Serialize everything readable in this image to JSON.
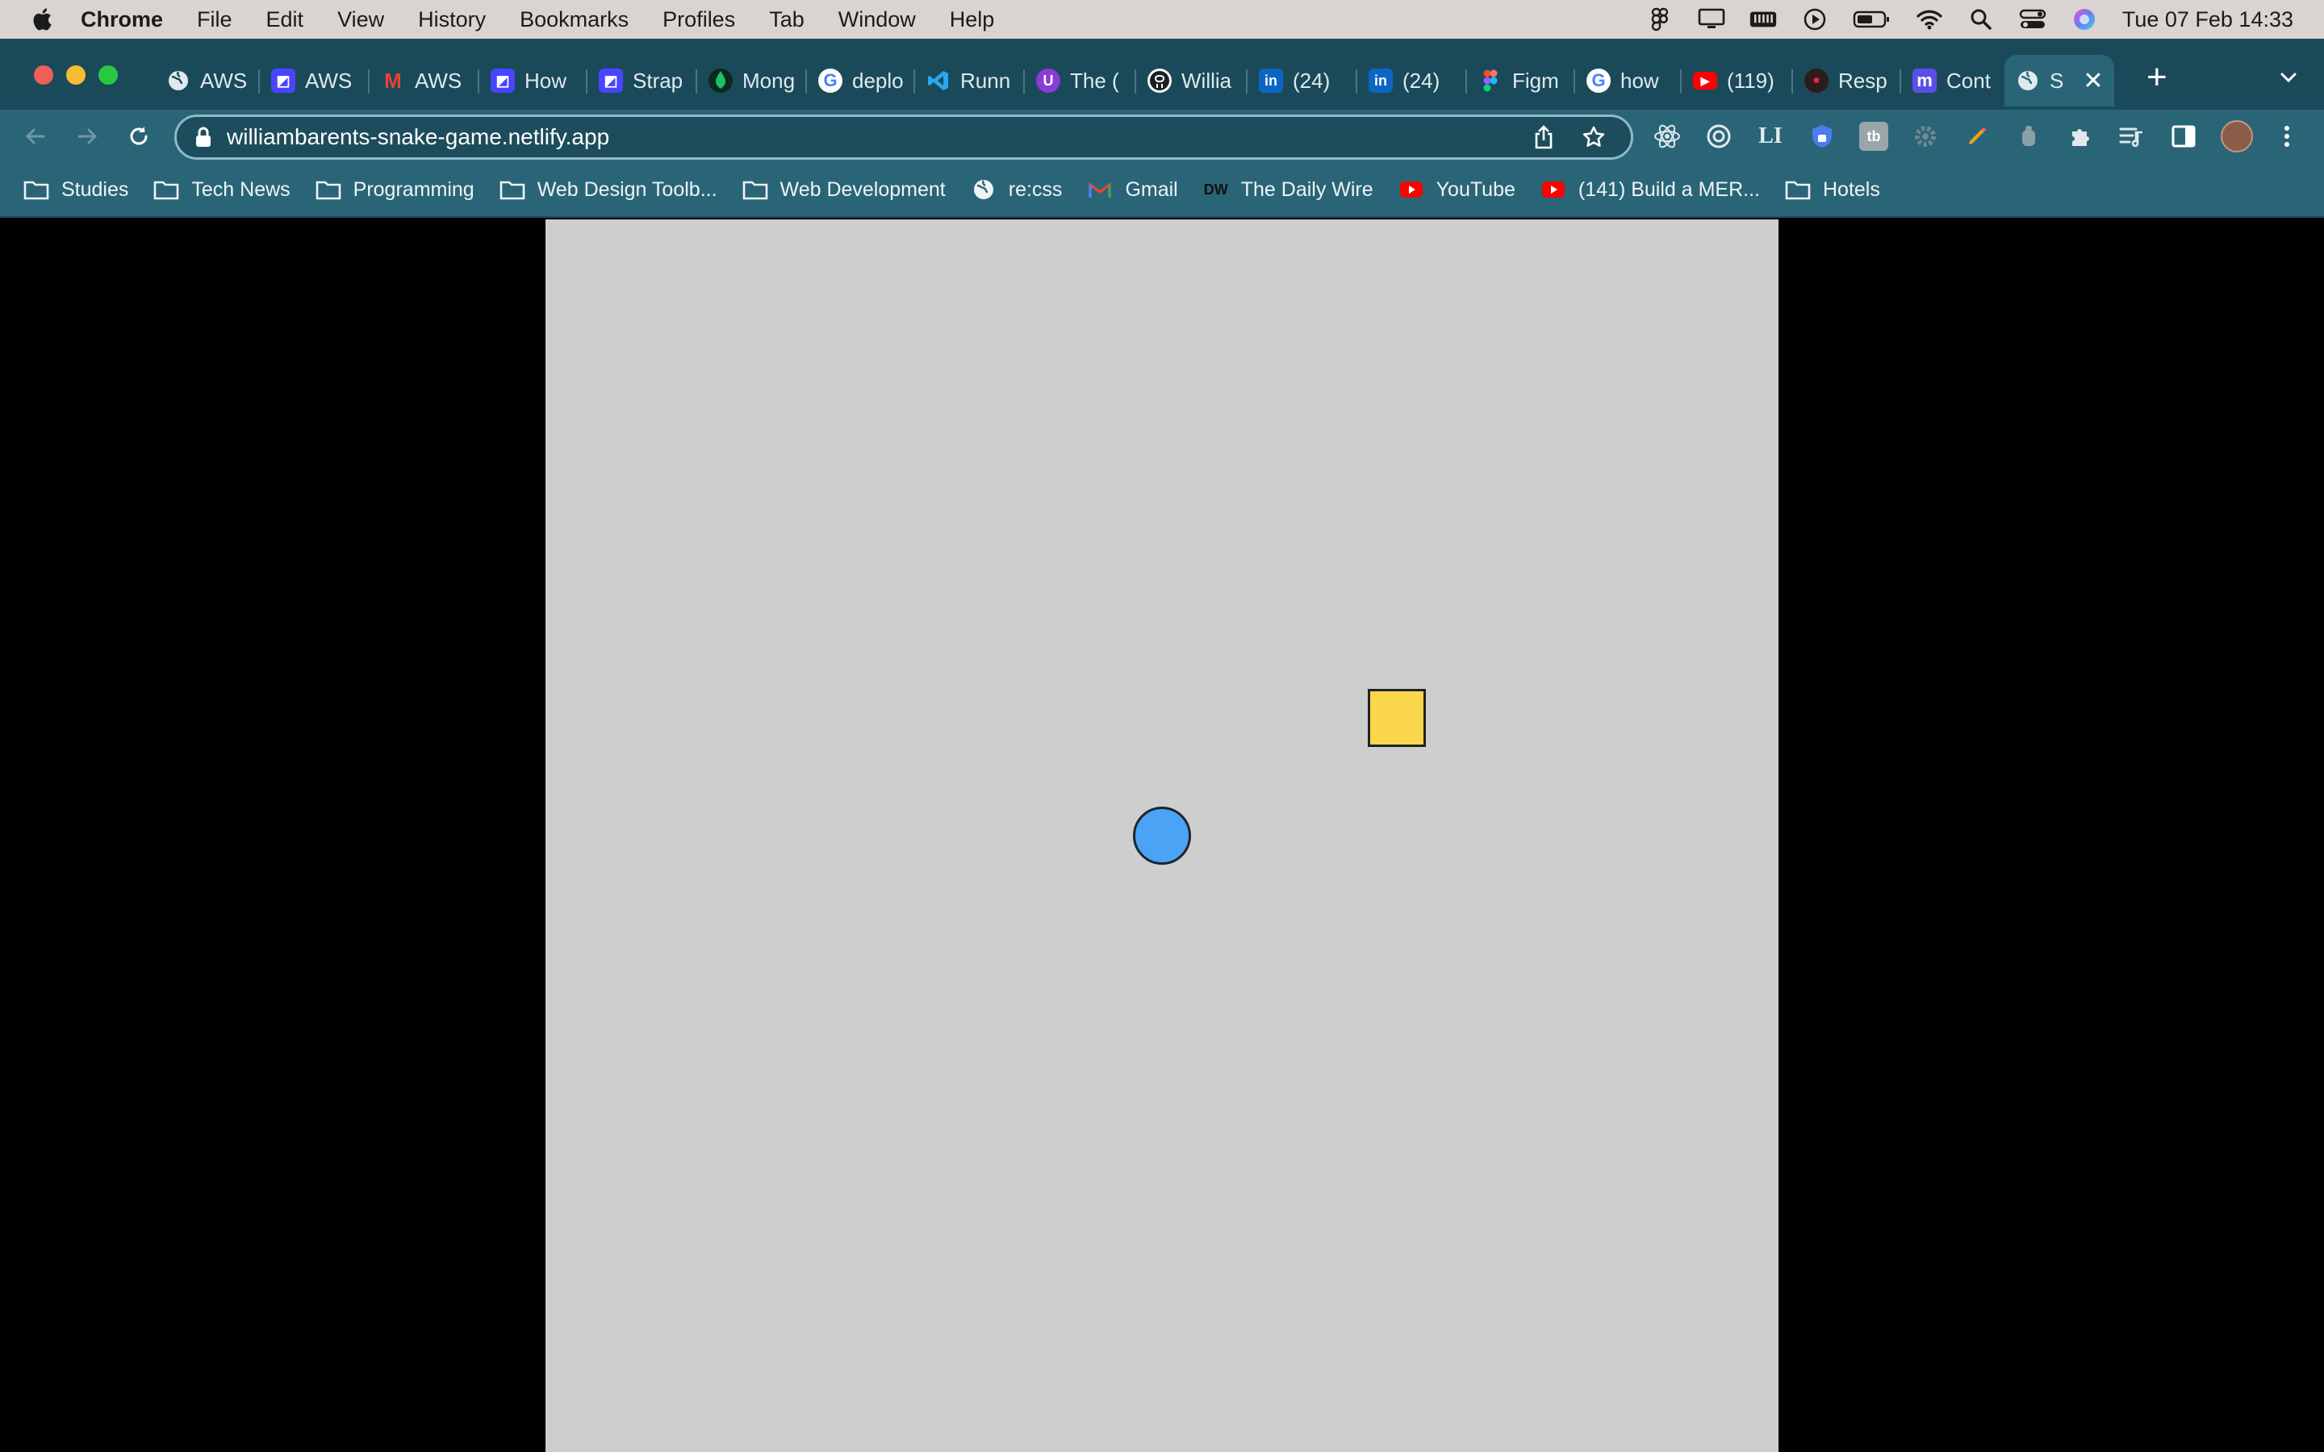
{
  "menubar": {
    "app_name": "Chrome",
    "items": [
      "File",
      "Edit",
      "View",
      "History",
      "Bookmarks",
      "Profiles",
      "Tab",
      "Window",
      "Help"
    ],
    "clock": "Tue 07 Feb  14:33",
    "status_icons": [
      "figma-icon",
      "display-icon",
      "memory-icon",
      "play-icon",
      "battery-icon",
      "wifi-icon",
      "spotlight-search-icon",
      "control-center-icon",
      "siri-icon"
    ]
  },
  "tabs": [
    {
      "title": "AWS",
      "icon": "globe-icon"
    },
    {
      "title": "AWS",
      "icon": "strapi-icon"
    },
    {
      "title": "AWS",
      "icon": "gmail-icon"
    },
    {
      "title": "How",
      "icon": "strapi-icon"
    },
    {
      "title": "Strap",
      "icon": "strapi-icon"
    },
    {
      "title": "Mong",
      "icon": "mongodb-icon"
    },
    {
      "title": "deplo",
      "icon": "google-icon"
    },
    {
      "title": "Runn",
      "icon": "vscode-icon"
    },
    {
      "title": "The (",
      "icon": "ublock-icon"
    },
    {
      "title": "Willia",
      "icon": "github-icon"
    },
    {
      "title": "(24)",
      "icon": "linkedin-icon"
    },
    {
      "title": "(24)",
      "icon": "linkedin-icon"
    },
    {
      "title": "Figm",
      "icon": "figma-icon"
    },
    {
      "title": "how",
      "icon": "google-icon"
    },
    {
      "title": "(119)",
      "icon": "youtube-icon"
    },
    {
      "title": "Resp",
      "icon": "spy-icon"
    },
    {
      "title": "Cont",
      "icon": "m-icon"
    },
    {
      "title": "S",
      "icon": "globe-icon",
      "active": true
    }
  ],
  "toolbar": {
    "url": "williambarents-snake-game.netlify.app",
    "extensions": [
      "react-devtools-icon",
      "target-icon",
      "LI",
      "shield-lock-icon",
      "tb",
      "gear-icon",
      "pencil-icon",
      "cup-icon",
      "puzzle-icon",
      "reading-list-icon",
      "side-panel-icon"
    ]
  },
  "bookmarks": [
    {
      "label": "Studies",
      "icon": "folder-icon"
    },
    {
      "label": "Tech News",
      "icon": "folder-icon"
    },
    {
      "label": "Programming",
      "icon": "folder-icon"
    },
    {
      "label": "Web Design Toolb...",
      "icon": "folder-icon"
    },
    {
      "label": "Web Development",
      "icon": "folder-icon"
    },
    {
      "label": "re:css",
      "icon": "globe-icon"
    },
    {
      "label": "Gmail",
      "icon": "gmail-icon"
    },
    {
      "label": "The Daily Wire",
      "icon": "dw-icon"
    },
    {
      "label": "YouTube",
      "icon": "youtube-icon"
    },
    {
      "label": "(141) Build a MER...",
      "icon": "youtube-icon"
    },
    {
      "label": "Hotels",
      "icon": "folder-icon"
    }
  ],
  "colors": {
    "board": "#cecece",
    "food": "#f9d64a",
    "snake": "#4aa3f5",
    "background": "#000000"
  }
}
